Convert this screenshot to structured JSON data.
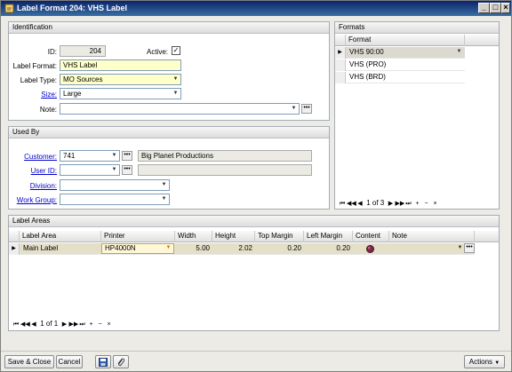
{
  "window": {
    "title": "Label Format 204: VHS Label"
  },
  "identification": {
    "section_title": "Identification",
    "id_label": "ID:",
    "id_value": "204",
    "active_label": "Active:",
    "active_checked": "✓",
    "format_label": "Label Format:",
    "format_value": "VHS Label",
    "type_label": "Label Type:",
    "type_value": "MO Sources",
    "size_label": "Size:",
    "size_value": "Large",
    "note_label": "Note:",
    "note_value": ""
  },
  "used_by": {
    "section_title": "Used By",
    "customer_label": "Customer:",
    "customer_value": "741",
    "customer_name": "Big Planet Productions",
    "user_label": "User ID:",
    "user_value": "",
    "user_name": "",
    "division_label": "Division:",
    "division_value": "",
    "workgroup_label": "Work Group:",
    "workgroup_value": ""
  },
  "formats": {
    "section_title": "Formats",
    "column": "Format",
    "rows": [
      "VHS 90:00",
      "VHS (PRO)",
      "VHS (BRD)"
    ],
    "nav_text": "1 of 3"
  },
  "label_areas": {
    "section_title": "Label Areas",
    "columns": [
      "Label Area",
      "Printer",
      "Width",
      "Height",
      "Top Margin",
      "Left Margin",
      "Content",
      "Note"
    ],
    "row": {
      "label_area": "Main  Label",
      "printer": "HP4000N",
      "width": "5.00",
      "height": "2.02",
      "top_margin": "0.20",
      "left_margin": "0.20",
      "note": ""
    },
    "nav_text": "1 of 1"
  },
  "footer": {
    "save_close": "Save & Close",
    "cancel": "Cancel",
    "actions": "Actions"
  },
  "colors": {
    "title_bar": "#0a246a",
    "required_field": "#ffffc8",
    "link": "#0000cc"
  }
}
